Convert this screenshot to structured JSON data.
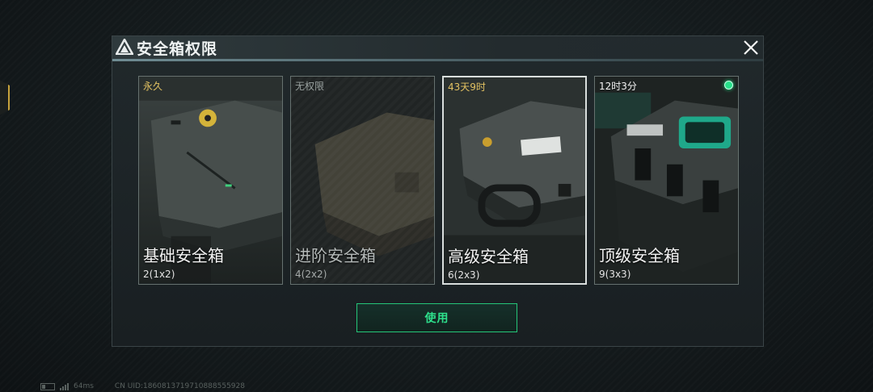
{
  "dialog": {
    "title": "安全箱权限",
    "logo_icon": "triangle-logo-icon",
    "close_icon": "close-icon"
  },
  "cards": [
    {
      "timer": "永久",
      "name": "基础安全箱",
      "capacity": "2(1x2)",
      "timer_color": "#e3c262",
      "locked": false,
      "selected": false,
      "active": false
    },
    {
      "timer": "无权限",
      "name": "进阶安全箱",
      "capacity": "4(2x2)",
      "timer_color": "#9aa2a0",
      "locked": true,
      "selected": false,
      "active": false
    },
    {
      "timer": "43天9时",
      "name": "高级安全箱",
      "capacity": "6(2x3)",
      "timer_color": "#e3c262",
      "locked": false,
      "selected": true,
      "active": false
    },
    {
      "timer": "12时3分",
      "name": "顶级安全箱",
      "capacity": "9(3x3)",
      "timer_color": "#f2f2f2",
      "locked": false,
      "selected": false,
      "active": true
    }
  ],
  "use_button": {
    "label": "使用",
    "accent": "#2ee08c"
  },
  "footer": {
    "ping": "64ms",
    "uid": "CN UID:1860813719710888555928"
  }
}
